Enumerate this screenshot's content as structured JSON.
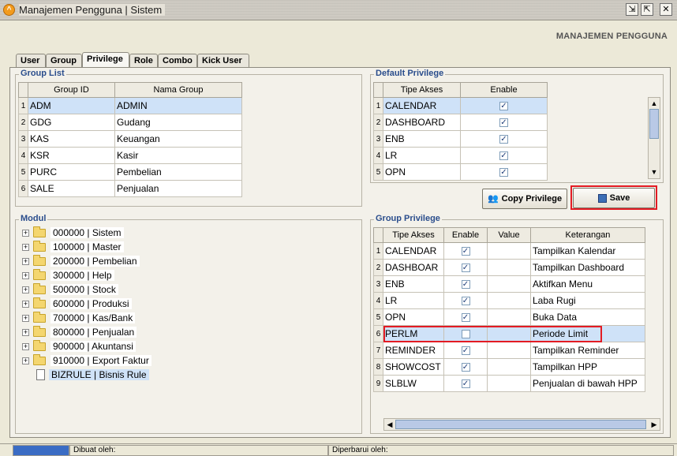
{
  "window": {
    "title": "Manajemen Pengguna | Sistem",
    "buttons": [
      "restore-icon",
      "maximize-icon",
      "close-icon"
    ]
  },
  "header": {
    "label": "MANAJEMEN PENGGUNA"
  },
  "tabs": [
    {
      "label": "User",
      "active": false
    },
    {
      "label": "Group",
      "active": false
    },
    {
      "label": "Privilege",
      "active": true
    },
    {
      "label": "Role",
      "active": false
    },
    {
      "label": "Combo",
      "active": false
    },
    {
      "label": "Kick User",
      "active": false
    }
  ],
  "group_list": {
    "title": "Group List",
    "columns": [
      "Group ID",
      "Nama Group"
    ],
    "rows": [
      {
        "n": "1",
        "id": "ADM",
        "name": "ADMIN",
        "selected": true
      },
      {
        "n": "2",
        "id": "GDG",
        "name": "Gudang"
      },
      {
        "n": "3",
        "id": "KAS",
        "name": "Keuangan"
      },
      {
        "n": "4",
        "id": "KSR",
        "name": "Kasir"
      },
      {
        "n": "5",
        "id": "PURC",
        "name": "Pembelian"
      },
      {
        "n": "6",
        "id": "SALE",
        "name": "Penjualan"
      }
    ]
  },
  "default_privilege": {
    "title": "Default Privilege",
    "columns": [
      "Tipe Akses",
      "Enable"
    ],
    "rows": [
      {
        "n": "1",
        "type": "CALENDAR",
        "enable": true,
        "selected": true
      },
      {
        "n": "2",
        "type": "DASHBOARD",
        "enable": true
      },
      {
        "n": "3",
        "type": "ENB",
        "enable": true
      },
      {
        "n": "4",
        "type": "LR",
        "enable": true
      },
      {
        "n": "5",
        "type": "OPN",
        "enable": true
      }
    ]
  },
  "buttons": {
    "copy_privilege": "Copy Privilege",
    "save": "Save"
  },
  "modul": {
    "title": "Modul",
    "items": [
      {
        "label": "000000 | Sistem",
        "folder": true
      },
      {
        "label": "100000 | Master",
        "folder": true
      },
      {
        "label": "200000 | Pembelian",
        "folder": true
      },
      {
        "label": "300000 | Help",
        "folder": true
      },
      {
        "label": "500000 | Stock",
        "folder": true
      },
      {
        "label": "600000 | Produksi",
        "folder": true
      },
      {
        "label": "700000 | Kas/Bank",
        "folder": true
      },
      {
        "label": "800000 | Penjualan",
        "folder": true
      },
      {
        "label": "900000 | Akuntansi",
        "folder": true
      },
      {
        "label": "910000 | Export Faktur",
        "folder": true
      },
      {
        "label": "BIZRULE | Bisnis Rule",
        "folder": false,
        "selected": true
      }
    ]
  },
  "group_privilege": {
    "title": "Group Privilege",
    "columns": [
      "Tipe Akses",
      "Enable",
      "Value",
      "Keterangan"
    ],
    "rows": [
      {
        "n": "1",
        "type": "CALENDAR",
        "enable": true,
        "value": "",
        "desc": "Tampilkan Kalendar"
      },
      {
        "n": "2",
        "type": "DASHBOAR",
        "enable": true,
        "value": "",
        "desc": "Tampilkan Dashboard"
      },
      {
        "n": "3",
        "type": "ENB",
        "enable": true,
        "value": "",
        "desc": "Aktifkan Menu"
      },
      {
        "n": "4",
        "type": "LR",
        "enable": true,
        "value": "",
        "desc": "Laba Rugi"
      },
      {
        "n": "5",
        "type": "OPN",
        "enable": true,
        "value": "",
        "desc": "Buka Data"
      },
      {
        "n": "6",
        "type": "PERLM",
        "enable": false,
        "value": "",
        "desc": "Periode Limit",
        "selected": true
      },
      {
        "n": "7",
        "type": "REMINDER",
        "enable": true,
        "value": "",
        "desc": "Tampilkan Reminder"
      },
      {
        "n": "8",
        "type": "SHOWCOST",
        "enable": true,
        "value": "",
        "desc": "Tampilkan HPP"
      },
      {
        "n": "9",
        "type": "SLBLW",
        "enable": true,
        "value": "",
        "desc": "Penjualan di bawah HPP"
      }
    ]
  },
  "status": {
    "created_by": "Dibuat oleh:",
    "updated_by": "Diperbarui oleh:"
  },
  "colors": {
    "accent": "#2a4d8c",
    "selection": "#cfe2f8",
    "highlight": "#e31b23"
  }
}
